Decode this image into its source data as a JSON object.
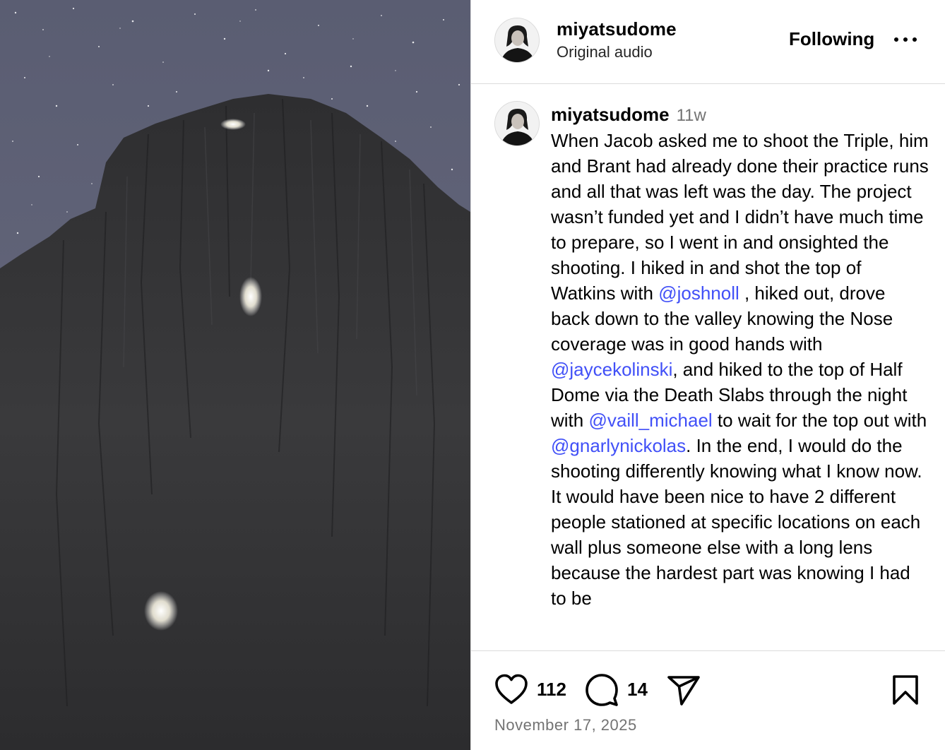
{
  "header": {
    "username": "miyatsudome",
    "audio": "Original audio",
    "follow_label": "Following"
  },
  "caption": {
    "username": "miyatsudome",
    "time": "11w",
    "segments": [
      "When Jacob asked me to shoot the Triple, him and Brant had already done their practice runs and all that was left was the day. The project wasn’t funded yet and I didn’t have much time to prepare, so I went in and onsighted the shooting. I hiked in and shot the top of Watkins with ",
      "@joshnoll",
      " , hiked out, drove back down to the valley knowing the Nose coverage was in good hands with ",
      "@jaycekolinski",
      ", and hiked to the top of Half Dome via the Death Slabs through the night with ",
      "@vaill_michael",
      " to wait for the top out with ",
      "@gnarlynickolas",
      ". In the end, I would do the shooting differently knowing what I know now. It would have been nice to have 2 different people stationed at specific locations on each wall plus someone else with a long lens because the hardest part was knowing I had to be"
    ]
  },
  "actions": {
    "likes": "112",
    "comments": "14"
  },
  "post_date": "November 17, 2025",
  "icons": {
    "like": "heart-icon",
    "comment": "comment-bubble-icon",
    "share": "paper-plane-icon",
    "save": "bookmark-icon",
    "more": "more-horizontal-icon"
  }
}
